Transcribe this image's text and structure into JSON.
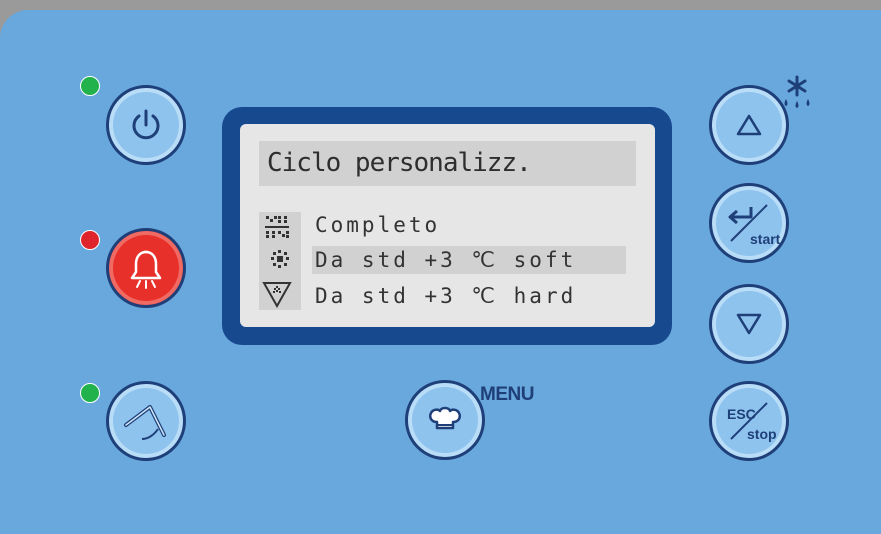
{
  "display": {
    "title": "Ciclo personalizz.",
    "items": [
      {
        "label": "Completo",
        "selected": false,
        "icon": "full-cycle-icon"
      },
      {
        "label": "Da std +3 ℃ soft",
        "selected": true,
        "icon": "snowflake-dot-icon"
      },
      {
        "label": "Da std +3 ℃ hard",
        "selected": false,
        "icon": "triangle-snow-icon"
      }
    ]
  },
  "leds": {
    "power": {
      "color": "#22b24c"
    },
    "alarm": {
      "color": "#e0242b"
    },
    "probe": {
      "color": "#22b24c"
    }
  },
  "buttons": {
    "menu_label": "MENU",
    "esc_top": "ESC",
    "esc_bottom": "stop",
    "start_label": "start"
  },
  "colors": {
    "panel": "#69a8dc",
    "button_fill": "#8ec3ee",
    "button_border": "#1f3f79",
    "alarm_button": "#e8302b",
    "bezel": "#17498f",
    "lcd_bg": "#e6e6e6",
    "lcd_highlight": "#d1d1d1"
  }
}
